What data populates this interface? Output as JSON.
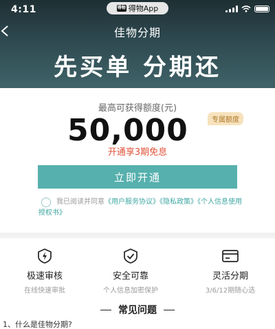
{
  "status_bar": {
    "time": "4:11",
    "app_name": "得物App",
    "app_icon_text": "得物"
  },
  "nav": {
    "title": "佳物分期"
  },
  "hero": {
    "slogan": "先买单 分期还"
  },
  "credit": {
    "label": "最高可获得额度(元)",
    "amount": "50,000",
    "badge": "专属额度",
    "promo": "开通享3期免息"
  },
  "cta": {
    "label": "立即开通"
  },
  "agreement": {
    "prefix": "我已阅读并同意",
    "links": [
      "《用户服务协议》",
      "《隐私政策》",
      "《个人信息使用授权书》"
    ]
  },
  "features": [
    {
      "icon": "lightning-shield-icon",
      "title": "极速审核",
      "desc": "在线快速审批"
    },
    {
      "icon": "check-shield-icon",
      "title": "安全可靠",
      "desc": "个人信息加密保护"
    },
    {
      "icon": "card-icon",
      "title": "灵活分期",
      "desc": "3/6/12期随心选"
    }
  ],
  "faq": {
    "heading": "常见问题",
    "first_question": "1、什么是佳物分期?"
  },
  "colors": {
    "hero": "#2e4950",
    "accent": "#56b0ad",
    "promo": "#e1523a",
    "badge_bg": "#f6e2bd"
  }
}
